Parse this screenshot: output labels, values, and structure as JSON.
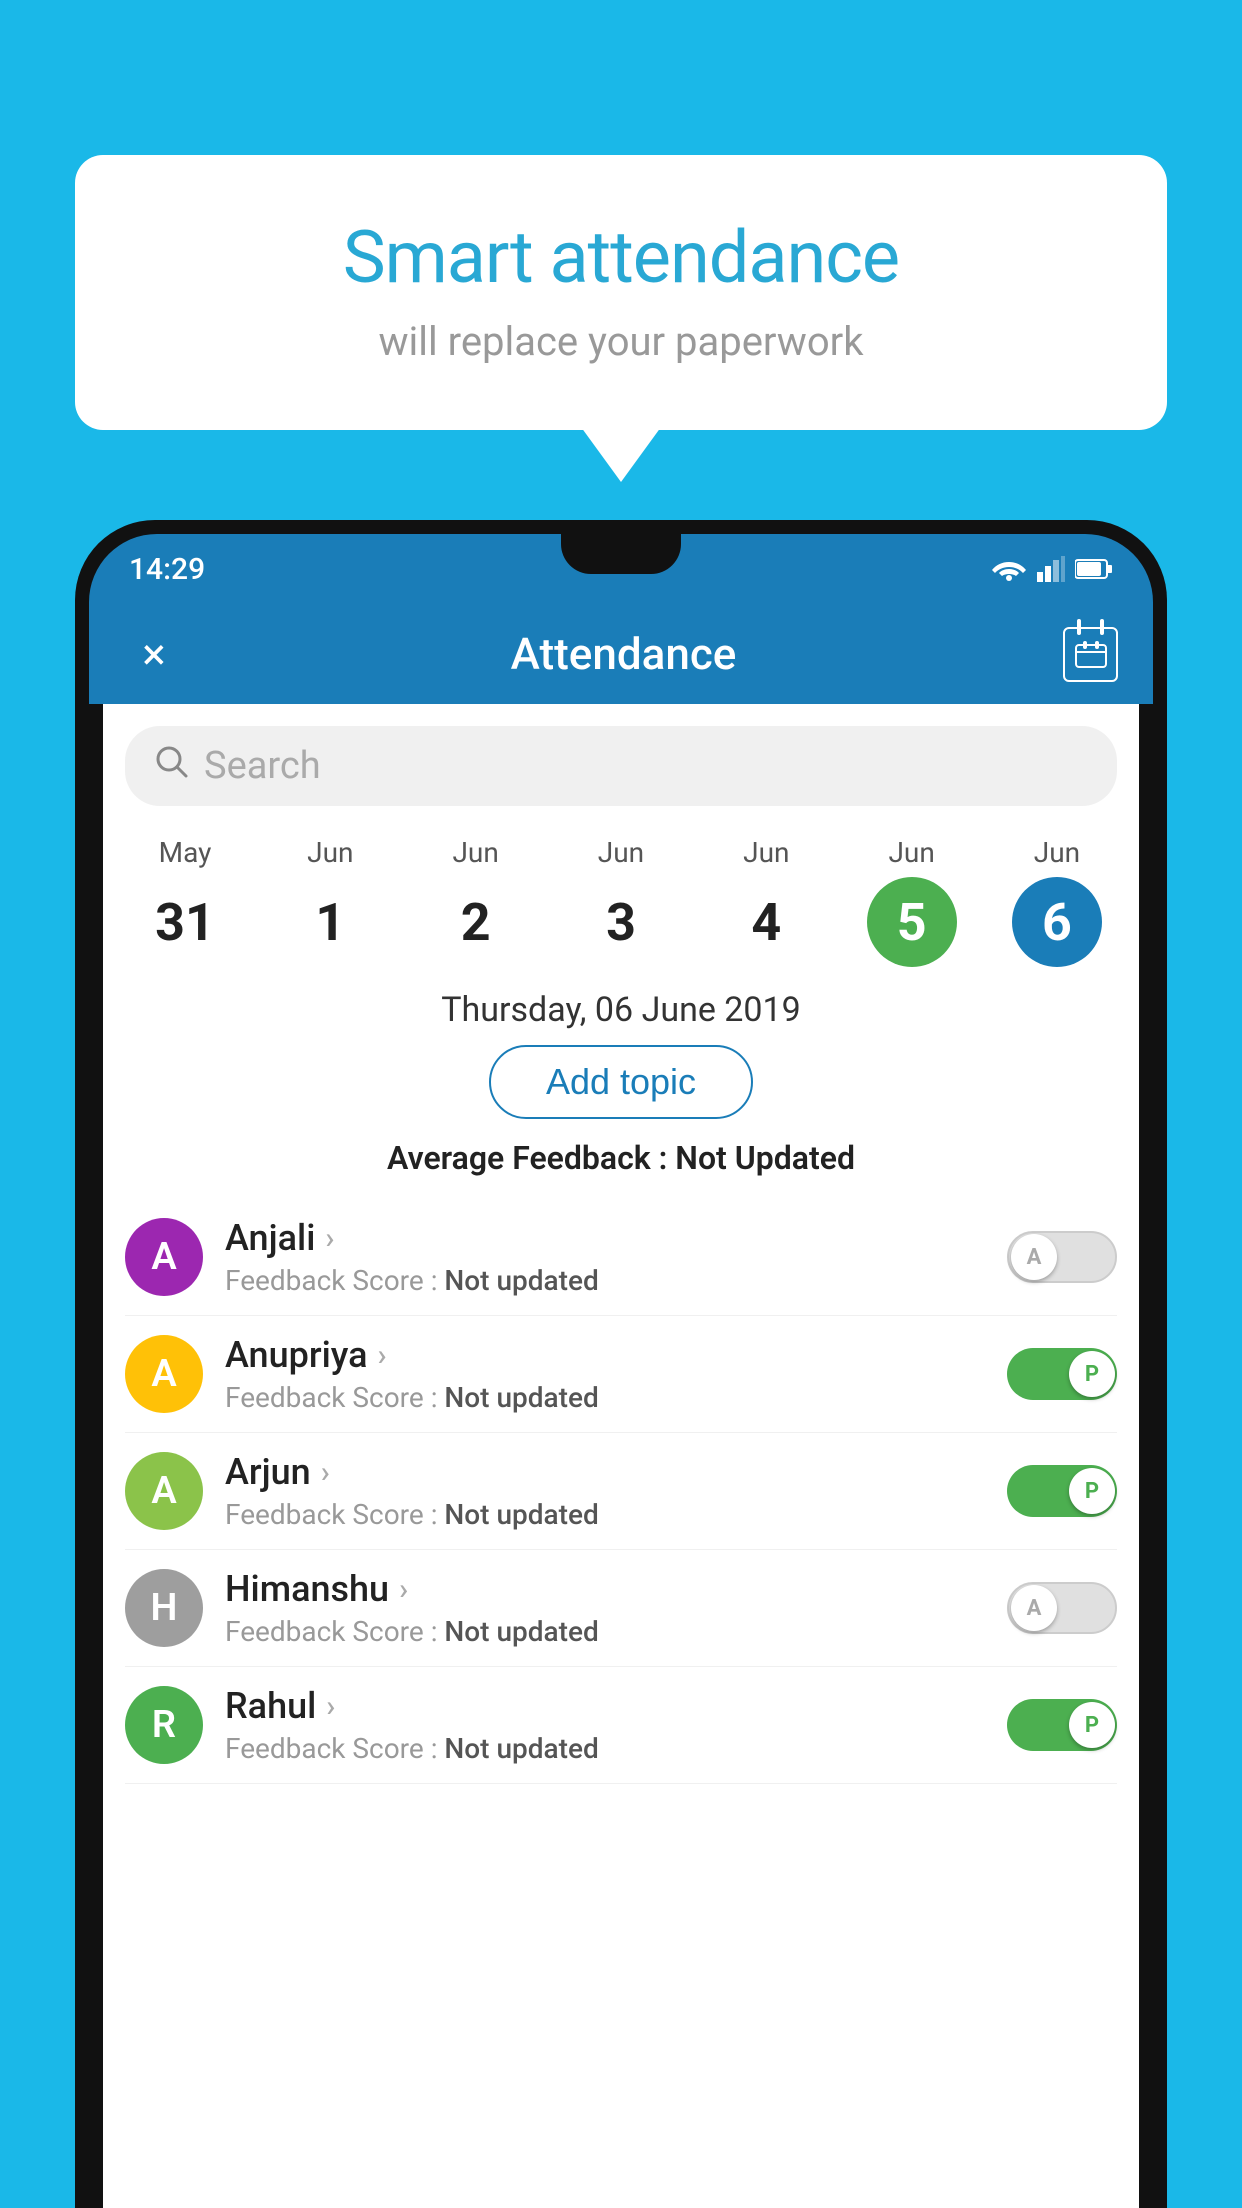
{
  "background_color": "#1ab8e8",
  "speech_bubble": {
    "title": "Smart attendance",
    "subtitle": "will replace your paperwork"
  },
  "status_bar": {
    "time": "14:29"
  },
  "app_bar": {
    "title": "Attendance",
    "close_label": "×"
  },
  "search": {
    "placeholder": "Search"
  },
  "calendar": {
    "days": [
      {
        "month": "May",
        "num": "31",
        "state": "normal"
      },
      {
        "month": "Jun",
        "num": "1",
        "state": "normal"
      },
      {
        "month": "Jun",
        "num": "2",
        "state": "normal"
      },
      {
        "month": "Jun",
        "num": "3",
        "state": "normal"
      },
      {
        "month": "Jun",
        "num": "4",
        "state": "normal"
      },
      {
        "month": "Jun",
        "num": "5",
        "state": "today"
      },
      {
        "month": "Jun",
        "num": "6",
        "state": "selected"
      }
    ]
  },
  "selected_date": "Thursday, 06 June 2019",
  "add_topic_label": "Add topic",
  "avg_feedback_label": "Average Feedback :",
  "avg_feedback_value": "Not Updated",
  "students": [
    {
      "name": "Anjali",
      "avatar_letter": "A",
      "avatar_color": "#9c27b0",
      "feedback_label": "Feedback Score :",
      "feedback_value": "Not updated",
      "toggle_state": "off",
      "toggle_label": "A"
    },
    {
      "name": "Anupriya",
      "avatar_letter": "A",
      "avatar_color": "#ffc107",
      "feedback_label": "Feedback Score :",
      "feedback_value": "Not updated",
      "toggle_state": "on",
      "toggle_label": "P"
    },
    {
      "name": "Arjun",
      "avatar_letter": "A",
      "avatar_color": "#8bc34a",
      "feedback_label": "Feedback Score :",
      "feedback_value": "Not updated",
      "toggle_state": "on",
      "toggle_label": "P"
    },
    {
      "name": "Himanshu",
      "avatar_letter": "H",
      "avatar_color": "#9e9e9e",
      "feedback_label": "Feedback Score :",
      "feedback_value": "Not updated",
      "toggle_state": "off",
      "toggle_label": "A"
    },
    {
      "name": "Rahul",
      "avatar_letter": "R",
      "avatar_color": "#4caf50",
      "feedback_label": "Feedback Score :",
      "feedback_value": "Not updated",
      "toggle_state": "on",
      "toggle_label": "P"
    }
  ]
}
